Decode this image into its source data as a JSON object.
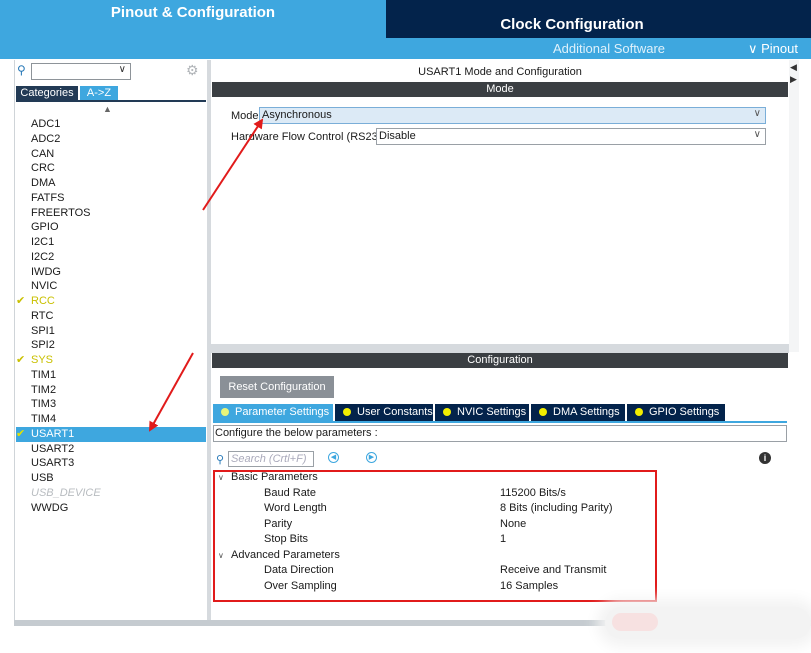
{
  "tabs": {
    "pinout": "Pinout & Configuration",
    "clock": "Clock Configuration",
    "additional": "Additional Software",
    "pinout_menu": "∨ Pinout"
  },
  "left": {
    "search_value": "",
    "categories_label": "Categories",
    "az_label": "A->Z",
    "peripherals": [
      {
        "label": "ADC1",
        "state": "normal"
      },
      {
        "label": "ADC2",
        "state": "normal"
      },
      {
        "label": "CAN",
        "state": "normal"
      },
      {
        "label": "CRC",
        "state": "normal"
      },
      {
        "label": "DMA",
        "state": "normal"
      },
      {
        "label": "FATFS",
        "state": "normal"
      },
      {
        "label": "FREERTOS",
        "state": "normal"
      },
      {
        "label": "GPIO",
        "state": "normal"
      },
      {
        "label": "I2C1",
        "state": "normal"
      },
      {
        "label": "I2C2",
        "state": "normal"
      },
      {
        "label": "IWDG",
        "state": "normal"
      },
      {
        "label": "NVIC",
        "state": "normal"
      },
      {
        "label": "RCC",
        "state": "checked"
      },
      {
        "label": "RTC",
        "state": "normal"
      },
      {
        "label": "SPI1",
        "state": "normal"
      },
      {
        "label": "SPI2",
        "state": "normal"
      },
      {
        "label": "SYS",
        "state": "checked"
      },
      {
        "label": "TIM1",
        "state": "normal"
      },
      {
        "label": "TIM2",
        "state": "normal"
      },
      {
        "label": "TIM3",
        "state": "normal"
      },
      {
        "label": "TIM4",
        "state": "normal"
      },
      {
        "label": "USART1",
        "state": "selected"
      },
      {
        "label": "USART2",
        "state": "normal"
      },
      {
        "label": "USART3",
        "state": "normal"
      },
      {
        "label": "USB",
        "state": "normal"
      },
      {
        "label": "USB_DEVICE",
        "state": "disabled"
      },
      {
        "label": "WWDG",
        "state": "normal"
      }
    ]
  },
  "mode": {
    "title": "USART1 Mode and Configuration",
    "header": "Mode",
    "mode_label": "Mode",
    "mode_value": "Asynchronous",
    "hfc_label": "Hardware Flow Control (RS232)",
    "hfc_value": "Disable"
  },
  "config": {
    "header": "Configuration",
    "reset_label": "Reset Configuration",
    "tabs": [
      "Parameter Settings",
      "User Constants",
      "NVIC Settings",
      "DMA Settings",
      "GPIO Settings"
    ],
    "active_tab": 0,
    "hint": "Configure the below parameters :",
    "search_placeholder": "Search (Crtl+F)",
    "groups": [
      {
        "name": "Basic Parameters",
        "params": [
          {
            "name": "Baud Rate",
            "value": "115200 Bits/s"
          },
          {
            "name": "Word Length",
            "value": "8 Bits (including Parity)"
          },
          {
            "name": "Parity",
            "value": "None"
          },
          {
            "name": "Stop Bits",
            "value": "1"
          }
        ]
      },
      {
        "name": "Advanced Parameters",
        "params": [
          {
            "name": "Data Direction",
            "value": "Receive and Transmit"
          },
          {
            "name": "Over Sampling",
            "value": "16 Samples"
          }
        ]
      }
    ]
  },
  "colors": {
    "accent": "#3ea7df",
    "dark": "#03234b",
    "highlight": "#e11b1b",
    "check": "#c9c000"
  }
}
